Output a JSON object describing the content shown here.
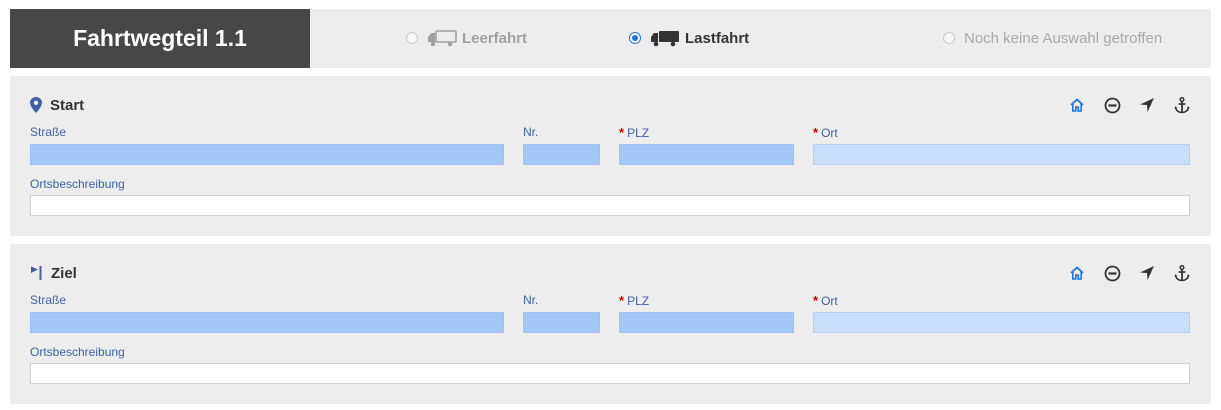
{
  "header": {
    "title": "Fahrtwegteil 1.1",
    "options": [
      {
        "label": "Leerfahrt",
        "checked": false,
        "icon": "truck-icon"
      },
      {
        "label": "Lastfahrt",
        "checked": true,
        "icon": "truck-icon"
      },
      {
        "label": "Noch keine Auswahl getroffen",
        "checked": false
      }
    ]
  },
  "start": {
    "title": "Start",
    "icon": "map-pin-icon",
    "street_label": "Straße",
    "nr_label": "Nr.",
    "plz_label": "PLZ",
    "ort_label": "Ort",
    "required_mark": "*",
    "desc_label": "Ortsbeschreibung",
    "street_value": "",
    "nr_value": "",
    "plz_value": "",
    "ort_value": "",
    "desc_value": ""
  },
  "ziel": {
    "title": "Ziel",
    "icon": "flag-icon",
    "street_label": "Straße",
    "nr_label": "Nr.",
    "plz_label": "PLZ",
    "ort_label": "Ort",
    "required_mark": "*",
    "desc_label": "Ortsbeschreibung",
    "street_value": "",
    "nr_value": "",
    "plz_value": "",
    "ort_value": "",
    "desc_value": ""
  },
  "tools": [
    "home-icon",
    "minus-circle-icon",
    "location-arrow-icon",
    "anchor-icon"
  ],
  "colors": {
    "title_bg": "#474747",
    "panel_bg": "#ededed",
    "accent": "#1a73e8",
    "label": "#3d5fa8",
    "required": "#cc0000",
    "field_bg": "#a3c8f7"
  }
}
